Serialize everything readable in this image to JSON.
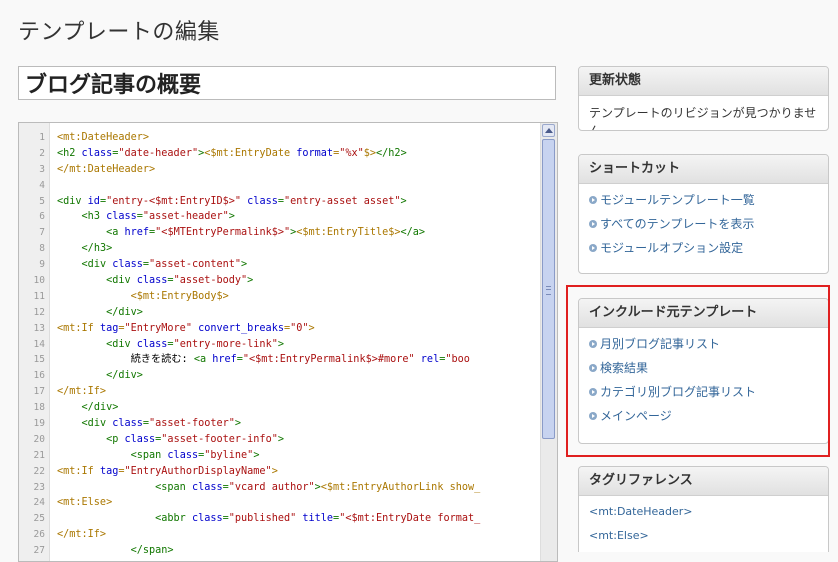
{
  "page": {
    "title": "テンプレートの編集"
  },
  "template_name": {
    "value": "ブログ記事の概要"
  },
  "editor": {
    "lines": [
      {
        "n": "1",
        "segs": [
          [
            "mt",
            "<mt:DateHeader>"
          ]
        ]
      },
      {
        "n": "2",
        "segs": [
          [
            "tag",
            "<h2 "
          ],
          [
            "attr",
            "class"
          ],
          [
            "tag",
            "="
          ],
          [
            "val",
            "\"date-header\""
          ],
          [
            "tag",
            ">"
          ],
          [
            "mt",
            "<$mt:EntryDate "
          ],
          [
            "attr",
            "format"
          ],
          [
            "mt",
            "="
          ],
          [
            "val",
            "\"%x\""
          ],
          [
            "mt",
            "$>"
          ],
          [
            "tag",
            "</h2>"
          ]
        ]
      },
      {
        "n": "3",
        "segs": [
          [
            "mt",
            "</mt:DateHeader>"
          ]
        ]
      },
      {
        "n": "4",
        "segs": []
      },
      {
        "n": "5",
        "segs": [
          [
            "tag",
            "<div "
          ],
          [
            "attr",
            "id"
          ],
          [
            "tag",
            "="
          ],
          [
            "val",
            "\"entry-<$mt:EntryID$>\""
          ],
          [
            "tag",
            " "
          ],
          [
            "attr",
            "class"
          ],
          [
            "tag",
            "="
          ],
          [
            "val",
            "\"entry-asset asset\""
          ],
          [
            "tag",
            ">"
          ]
        ]
      },
      {
        "n": "6",
        "segs": [
          [
            "text",
            "    "
          ],
          [
            "tag",
            "<h3 "
          ],
          [
            "attr",
            "class"
          ],
          [
            "tag",
            "="
          ],
          [
            "val",
            "\"asset-header\""
          ],
          [
            "tag",
            ">"
          ]
        ]
      },
      {
        "n": "7",
        "segs": [
          [
            "text",
            "        "
          ],
          [
            "tag",
            "<a "
          ],
          [
            "attr",
            "href"
          ],
          [
            "tag",
            "="
          ],
          [
            "val",
            "\"<$MTEntryPermalink$>\""
          ],
          [
            "tag",
            ">"
          ],
          [
            "mt",
            "<$mt:EntryTitle$>"
          ],
          [
            "tag",
            "</a>"
          ]
        ]
      },
      {
        "n": "8",
        "segs": [
          [
            "text",
            "    "
          ],
          [
            "tag",
            "</h3>"
          ]
        ]
      },
      {
        "n": "9",
        "segs": [
          [
            "text",
            "    "
          ],
          [
            "tag",
            "<div "
          ],
          [
            "attr",
            "class"
          ],
          [
            "tag",
            "="
          ],
          [
            "val",
            "\"asset-content\""
          ],
          [
            "tag",
            ">"
          ]
        ]
      },
      {
        "n": "10",
        "segs": [
          [
            "text",
            "        "
          ],
          [
            "tag",
            "<div "
          ],
          [
            "attr",
            "class"
          ],
          [
            "tag",
            "="
          ],
          [
            "val",
            "\"asset-body\""
          ],
          [
            "tag",
            ">"
          ]
        ]
      },
      {
        "n": "11",
        "segs": [
          [
            "text",
            "            "
          ],
          [
            "mt",
            "<$mt:EntryBody$>"
          ]
        ]
      },
      {
        "n": "12",
        "segs": [
          [
            "text",
            "        "
          ],
          [
            "tag",
            "</div>"
          ]
        ]
      },
      {
        "n": "13",
        "segs": [
          [
            "mt",
            "<mt:If "
          ],
          [
            "attr",
            "tag"
          ],
          [
            "mt",
            "="
          ],
          [
            "val",
            "\"EntryMore\""
          ],
          [
            "mt",
            " "
          ],
          [
            "attr",
            "convert_breaks"
          ],
          [
            "mt",
            "="
          ],
          [
            "val",
            "\"0\""
          ],
          [
            "mt",
            ">"
          ]
        ]
      },
      {
        "n": "14",
        "segs": [
          [
            "text",
            "        "
          ],
          [
            "tag",
            "<div "
          ],
          [
            "attr",
            "class"
          ],
          [
            "tag",
            "="
          ],
          [
            "val",
            "\"entry-more-link\""
          ],
          [
            "tag",
            ">"
          ]
        ]
      },
      {
        "n": "15",
        "segs": [
          [
            "text",
            "            続きを読む: "
          ],
          [
            "tag",
            "<a "
          ],
          [
            "attr",
            "href"
          ],
          [
            "tag",
            "="
          ],
          [
            "val",
            "\"<$mt:EntryPermalink$>#more\""
          ],
          [
            "tag",
            " "
          ],
          [
            "attr",
            "rel"
          ],
          [
            "tag",
            "="
          ],
          [
            "val",
            "\"boo"
          ]
        ]
      },
      {
        "n": "16",
        "segs": [
          [
            "text",
            "        "
          ],
          [
            "tag",
            "</div>"
          ]
        ]
      },
      {
        "n": "17",
        "segs": [
          [
            "mt",
            "</mt:If>"
          ]
        ]
      },
      {
        "n": "18",
        "segs": [
          [
            "text",
            "    "
          ],
          [
            "tag",
            "</div>"
          ]
        ]
      },
      {
        "n": "19",
        "segs": [
          [
            "text",
            "    "
          ],
          [
            "tag",
            "<div "
          ],
          [
            "attr",
            "class"
          ],
          [
            "tag",
            "="
          ],
          [
            "val",
            "\"asset-footer\""
          ],
          [
            "tag",
            ">"
          ]
        ]
      },
      {
        "n": "20",
        "segs": [
          [
            "text",
            "        "
          ],
          [
            "tag",
            "<p "
          ],
          [
            "attr",
            "class"
          ],
          [
            "tag",
            "="
          ],
          [
            "val",
            "\"asset-footer-info\""
          ],
          [
            "tag",
            ">"
          ]
        ]
      },
      {
        "n": "21",
        "segs": [
          [
            "text",
            "            "
          ],
          [
            "tag",
            "<span "
          ],
          [
            "attr",
            "class"
          ],
          [
            "tag",
            "="
          ],
          [
            "val",
            "\"byline\""
          ],
          [
            "tag",
            ">"
          ]
        ]
      },
      {
        "n": "22",
        "segs": [
          [
            "mt",
            "<mt:If "
          ],
          [
            "attr",
            "tag"
          ],
          [
            "mt",
            "="
          ],
          [
            "val",
            "\"EntryAuthorDisplayName\""
          ],
          [
            "mt",
            ">"
          ]
        ]
      },
      {
        "n": "23",
        "segs": [
          [
            "text",
            "                "
          ],
          [
            "tag",
            "<span "
          ],
          [
            "attr",
            "class"
          ],
          [
            "tag",
            "="
          ],
          [
            "val",
            "\"vcard author\""
          ],
          [
            "tag",
            ">"
          ],
          [
            "mt",
            "<$mt:EntryAuthorLink show_"
          ]
        ]
      },
      {
        "n": "24",
        "segs": [
          [
            "mt",
            "<mt:Else>"
          ]
        ]
      },
      {
        "n": "25",
        "segs": [
          [
            "text",
            "                "
          ],
          [
            "tag",
            "<abbr "
          ],
          [
            "attr",
            "class"
          ],
          [
            "tag",
            "="
          ],
          [
            "val",
            "\"published\""
          ],
          [
            "tag",
            " "
          ],
          [
            "attr",
            "title"
          ],
          [
            "tag",
            "="
          ],
          [
            "val",
            "\"<$mt:EntryDate format_"
          ]
        ]
      },
      {
        "n": "26",
        "segs": [
          [
            "mt",
            "</mt:If>"
          ]
        ]
      },
      {
        "n": "27",
        "segs": [
          [
            "text",
            "            "
          ],
          [
            "tag",
            "</span>"
          ]
        ]
      }
    ]
  },
  "sidebar": {
    "update_status": {
      "title": "更新状態",
      "text": "テンプレートのリビジョンが見つかりません"
    },
    "shortcuts": {
      "title": "ショートカット",
      "links": [
        "モジュールテンプレート一覧",
        "すべてのテンプレートを表示",
        "モジュールオプション設定"
      ]
    },
    "include_source": {
      "title": "インクルード元テンプレート",
      "links": [
        "月別ブログ記事リスト",
        "検索結果",
        "カテゴリ別ブログ記事リスト",
        "メインページ"
      ]
    },
    "tag_reference": {
      "title": "タグリファレンス",
      "items": [
        "<mt:DateHeader>",
        "<mt:Else>"
      ]
    }
  },
  "colors": {
    "highlight_border": "#e02020",
    "link": "#336699",
    "tag": "#117700",
    "mt_tag": "#aa7700",
    "attribute": "#0000cc",
    "value": "#aa1111"
  }
}
